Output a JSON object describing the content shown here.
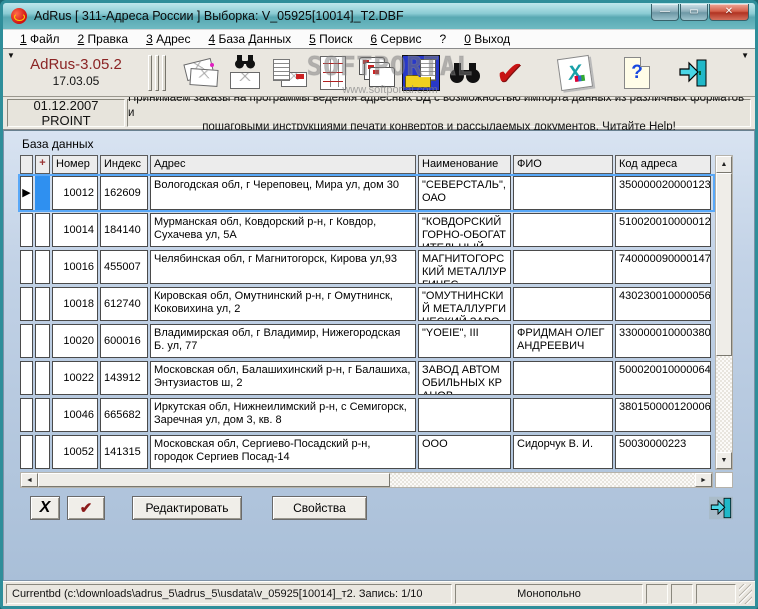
{
  "window": {
    "title": "AdRus  [ 311-Адреса России ]   Выборка: V_05925[10014]_T2.DBF",
    "controls": {
      "minimize": "—",
      "maximize": "▭",
      "close": "✕"
    }
  },
  "menu": {
    "items": [
      "1 Файл",
      "2 Правка",
      "3 Адрес",
      "4 База Данных",
      "5 Поиск",
      "6 Сервис",
      "?",
      "0 Выход"
    ]
  },
  "toolbar": {
    "version": "AdRus-3.05.2",
    "build_date": "17.03.05",
    "excel_letter": "X",
    "help_mark": "?",
    "check_mark": "✔",
    "watermark": {
      "line1": "SOFTPORTAL",
      "line2": "www.softportal.com"
    }
  },
  "infobar": {
    "date": "01.12.2007",
    "org": "PROINT",
    "message_line1": "Принимаем заказы на программы ведения адресных БД с возможностью импорта данных  из различных форматов и",
    "message_line2": "пошаговыми инструкциями печати конвертов и рассылаемых документов. Читайте Help!"
  },
  "main": {
    "panel_title": "База данных",
    "table": {
      "columns": [
        "",
        "+",
        "Номер",
        "Индекс",
        "Адрес",
        "Наименование",
        "ФИО",
        "Код адреса"
      ],
      "rows": [
        {
          "number": "10012",
          "index": "162609",
          "address": "Вологодская обл, г Череповец, Мира ул, дом 30",
          "name": "\"СЕВЕРСТАЛЬ\", ОАО",
          "fio": "",
          "code": "350000020000123",
          "selected": true
        },
        {
          "number": "10014",
          "index": "184140",
          "address": "Мурманская обл, Ковдорский р-н, г Ковдор, Сухачева ул, 5А",
          "name": "\"КОВДОРСКИЙ ГОРНО-ОБОГАТИТЕЛЬНЫЙ",
          "fio": "",
          "code": "510020010000012",
          "selected": false
        },
        {
          "number": "10016",
          "index": "455007",
          "address": "Челябинская обл, г Магнитогорск, Кирова ул,93",
          "name": "МАГНИТОГОРСКИЙ МЕТАЛЛУРГИЧЕС",
          "fio": "",
          "code": "740000090000147",
          "selected": false
        },
        {
          "number": "10018",
          "index": "612740",
          "address": "Кировская обл, Омутнинский р-н, г Омутнинск, Коковихина ул, 2",
          "name": "\"ОМУТНИНСКИЙ МЕТАЛЛУРГИЧЕСКИЙ ЗАВОД\", ОАО",
          "fio": "",
          "code": "430230010000056",
          "selected": false
        },
        {
          "number": "10020",
          "index": "600016",
          "address": "Владимирская обл, г Владимир, Нижегородская Б. ул, 77",
          "name": "\"YOEIE\", III",
          "fio": "ФРИДМАН ОЛЕГ АНДРЕЕВИЧ",
          "code": "330000010000380",
          "selected": false
        },
        {
          "number": "10022",
          "index": "143912",
          "address": "Московская обл, Балашихинский р-н, г Балашиха, Энтузиастов ш, 2",
          "name": "ЗАВОД АВТОМОБИЛЬНЫХ КРАНОВ",
          "fio": "",
          "code": "500020010000064",
          "selected": false
        },
        {
          "number": "10046",
          "index": "665682",
          "address": "Иркутская обл, Нижнеилимский р-н, с Семигорск, Заречная ул, дом 3, кв. 8",
          "name": "",
          "fio": "",
          "code": "380150000120006",
          "selected": false
        },
        {
          "number": "10052",
          "index": "141315",
          "address": "Московская обл, Сергиево-Посадский р-н, городок Сергиев Посад-14",
          "name": "ООО",
          "fio": "Сидорчук В. И.",
          "code": "50030000223",
          "selected": false
        }
      ]
    },
    "buttons": {
      "delete": "X",
      "confirm": "✔",
      "edit": "Редактировать",
      "properties": "Свойства"
    }
  },
  "statusbar": {
    "current_db": "Currentbd (c:\\downloads\\adrus_5\\adrus_5\\usdata\\v_05925[10014]_т2. Запись: 1/10",
    "mode": "Монопольно"
  }
}
